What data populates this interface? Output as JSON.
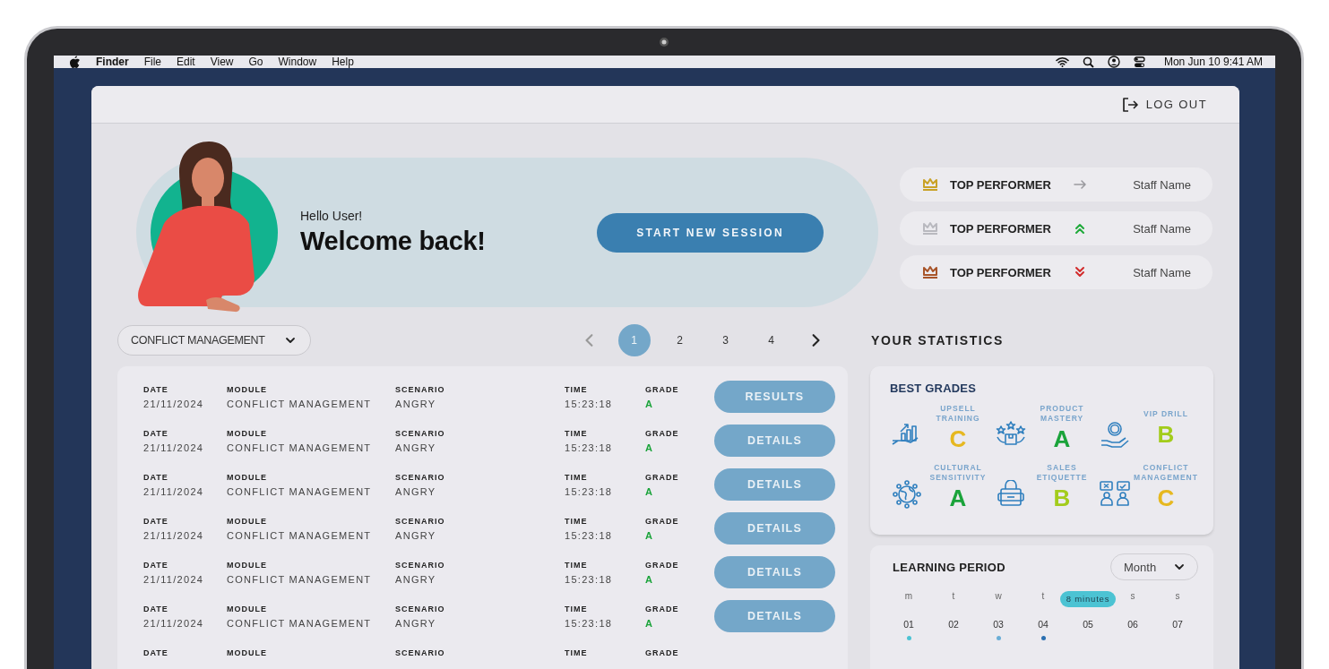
{
  "menu_bar": {
    "app": "Finder",
    "menus": [
      "File",
      "Edit",
      "View",
      "Go",
      "Window",
      "Help"
    ],
    "clock": "Mon Jun 10 9:41 AM"
  },
  "header": {
    "logout": "LOG OUT"
  },
  "hero": {
    "greeting": "Hello User!",
    "title": "Welcome back!",
    "button": "START NEW SESSION"
  },
  "performers": [
    {
      "label": "TOP PERFORMER",
      "kind": "same",
      "color": "#c9a227",
      "name": "Staff Name"
    },
    {
      "label": "TOP PERFORMER",
      "kind": "up",
      "color": "#b9b9bf",
      "name": "Staff Name"
    },
    {
      "label": "TOP PERFORMER",
      "kind": "down",
      "color": "#a8552a",
      "name": "Staff Name"
    }
  ],
  "filter": {
    "value": "CONFLICT MANAGEMENT"
  },
  "pagination": {
    "pages": [
      {
        "label": "1",
        "selected": true
      },
      {
        "label": "2",
        "selected": false
      },
      {
        "label": "3",
        "selected": false
      },
      {
        "label": "4",
        "selected": false
      }
    ]
  },
  "statistics_title": "YOUR STATISTICS",
  "sessions": [
    {
      "cells": [
        {
          "label": "DATE",
          "value": "21/11/2024"
        },
        {
          "label": "MODULE",
          "value": "CONFLICT MANAGEMENT"
        },
        {
          "label": "SCENARIO",
          "value": "ANGRY"
        },
        {
          "label": "TIME",
          "value": "15:23:18"
        },
        {
          "label": "GRADE",
          "value": "A"
        }
      ],
      "color": "#1aa33a",
      "action": "RESULTS"
    },
    {
      "cells": [
        {
          "label": "DATE",
          "value": "21/11/2024"
        },
        {
          "label": "MODULE",
          "value": "CONFLICT MANAGEMENT"
        },
        {
          "label": "SCENARIO",
          "value": "ANGRY"
        },
        {
          "label": "TIME",
          "value": "15:23:18"
        },
        {
          "label": "GRADE",
          "value": "A"
        }
      ],
      "color": "#1aa33a",
      "action": "DETAILS"
    },
    {
      "cells": [
        {
          "label": "DATE",
          "value": "21/11/2024"
        },
        {
          "label": "MODULE",
          "value": "CONFLICT MANAGEMENT"
        },
        {
          "label": "SCENARIO",
          "value": "ANGRY"
        },
        {
          "label": "TIME",
          "value": "15:23:18"
        },
        {
          "label": "GRADE",
          "value": "A"
        }
      ],
      "color": "#1aa33a",
      "action": "DETAILS"
    },
    {
      "cells": [
        {
          "label": "DATE",
          "value": "21/11/2024"
        },
        {
          "label": "MODULE",
          "value": "CONFLICT MANAGEMENT"
        },
        {
          "label": "SCENARIO",
          "value": "ANGRY"
        },
        {
          "label": "TIME",
          "value": "15:23:18"
        },
        {
          "label": "GRADE",
          "value": "A"
        }
      ],
      "color": "#1aa33a",
      "action": "DETAILS"
    },
    {
      "cells": [
        {
          "label": "DATE",
          "value": "21/11/2024"
        },
        {
          "label": "MODULE",
          "value": "CONFLICT MANAGEMENT"
        },
        {
          "label": "SCENARIO",
          "value": "ANGRY"
        },
        {
          "label": "TIME",
          "value": "15:23:18"
        },
        {
          "label": "GRADE",
          "value": "A"
        }
      ],
      "color": "#1aa33a",
      "action": "DETAILS"
    },
    {
      "cells": [
        {
          "label": "DATE",
          "value": "21/11/2024"
        },
        {
          "label": "MODULE",
          "value": "CONFLICT MANAGEMENT"
        },
        {
          "label": "SCENARIO",
          "value": "ANGRY"
        },
        {
          "label": "TIME",
          "value": "15:23:18"
        },
        {
          "label": "GRADE",
          "value": "A"
        }
      ],
      "color": "#1aa33a",
      "action": "DETAILS"
    },
    {
      "cells": [
        {
          "label": "DATE"
        },
        {
          "label": "MODULE"
        },
        {
          "label": "SCENARIO"
        },
        {
          "label": "TIME"
        },
        {
          "label": "GRADE"
        }
      ]
    }
  ],
  "best_grades": {
    "title": "BEST GRADES",
    "items": [
      {
        "name": "UPSELL TRAINING",
        "grade": "C",
        "color": "#e6b820",
        "kind": "chart"
      },
      {
        "name": "PRODUCT MASTERY",
        "grade": "A",
        "color": "#1aa33a",
        "kind": "stars"
      },
      {
        "name": "VIP DRILL",
        "grade": "B",
        "color": "#a3cc1c",
        "kind": "vip"
      },
      {
        "name": "CULTURAL SENSITIVITY",
        "grade": "A",
        "color": "#1aa33a",
        "kind": "globe"
      },
      {
        "name": "SALES ETIQUETTE",
        "grade": "B",
        "color": "#a3cc1c",
        "kind": "bag"
      },
      {
        "name": "CONFLICT MANAGEMENT",
        "grade": "C",
        "color": "#e6b820",
        "kind": "people"
      }
    ]
  },
  "learning_period": {
    "title": "LEARNING PERIOD",
    "select": "Month",
    "days": [
      {
        "weekday": "m",
        "day": "01",
        "color": "#4cc3d3"
      },
      {
        "weekday": "t",
        "day": "02"
      },
      {
        "weekday": "w",
        "day": "03",
        "color": "#6aaed6"
      },
      {
        "weekday": "t",
        "day": "04",
        "color": "#2a6fb0"
      },
      {
        "tooltip": "8 minutes",
        "day": "05"
      },
      {
        "weekday": "s",
        "day": "06"
      },
      {
        "weekday": "s",
        "day": "07"
      }
    ]
  }
}
